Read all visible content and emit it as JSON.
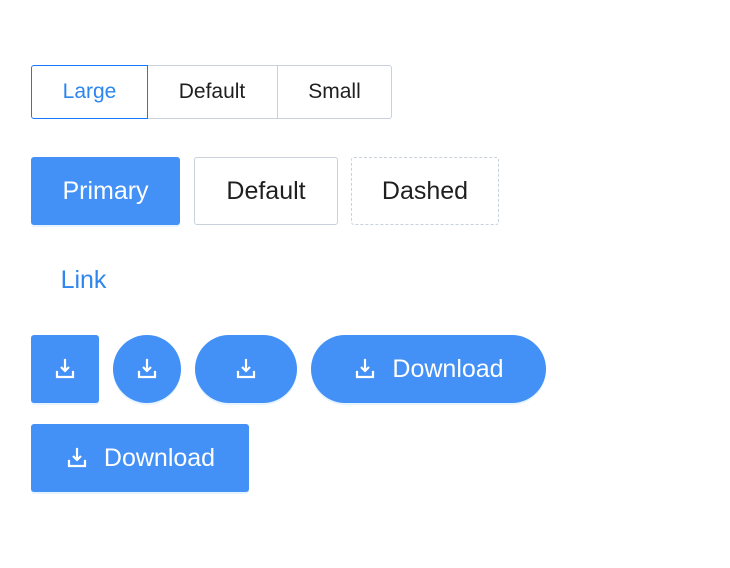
{
  "size_group": {
    "options": [
      "Large",
      "Default",
      "Small"
    ],
    "selected": "Large"
  },
  "buttons": {
    "primary_label": "Primary",
    "default_label": "Default",
    "dashed_label": "Dashed",
    "link_label": "Link",
    "download_label": "Download"
  },
  "icons": {
    "download": "download-icon"
  },
  "colors": {
    "primary": "#4390f7",
    "link": "#2f86ec",
    "selected_border": "#1677ff",
    "border": "#c9d1dc"
  }
}
